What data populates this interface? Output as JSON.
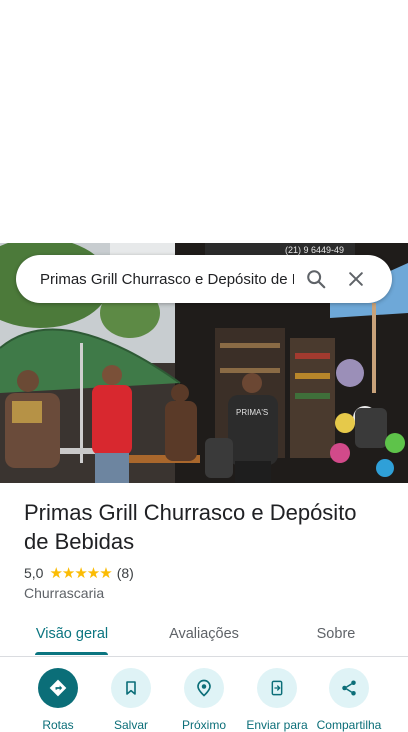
{
  "search": {
    "query": "Primas Grill Churrasco e Depósito de Bebidas"
  },
  "place": {
    "name": "Primas Grill Churrasco e Depósito de Bebidas",
    "rating": "5,0",
    "stars": "★★★★★",
    "review_count": "(8)",
    "category": "Churrascaria"
  },
  "tabs": [
    {
      "label": "Visão geral",
      "active": true
    },
    {
      "label": "Avaliações",
      "active": false
    },
    {
      "label": "Sobre",
      "active": false
    }
  ],
  "actions": [
    {
      "label": "Rotas",
      "icon": "directions-icon"
    },
    {
      "label": "Salvar",
      "icon": "bookmark-icon"
    },
    {
      "label": "Próximo",
      "icon": "nearby-icon"
    },
    {
      "label": "Enviar para",
      "icon": "send-to-phone-icon"
    },
    {
      "label": "Compartilha",
      "icon": "share-icon"
    }
  ],
  "photo": {
    "sign_text": "(21) 9 6449-49",
    "shirt_text": "PRIMA'S"
  },
  "colors": {
    "accent": "#0b7580",
    "action_bg": "#dff3f6",
    "star": "#fbbc04"
  }
}
